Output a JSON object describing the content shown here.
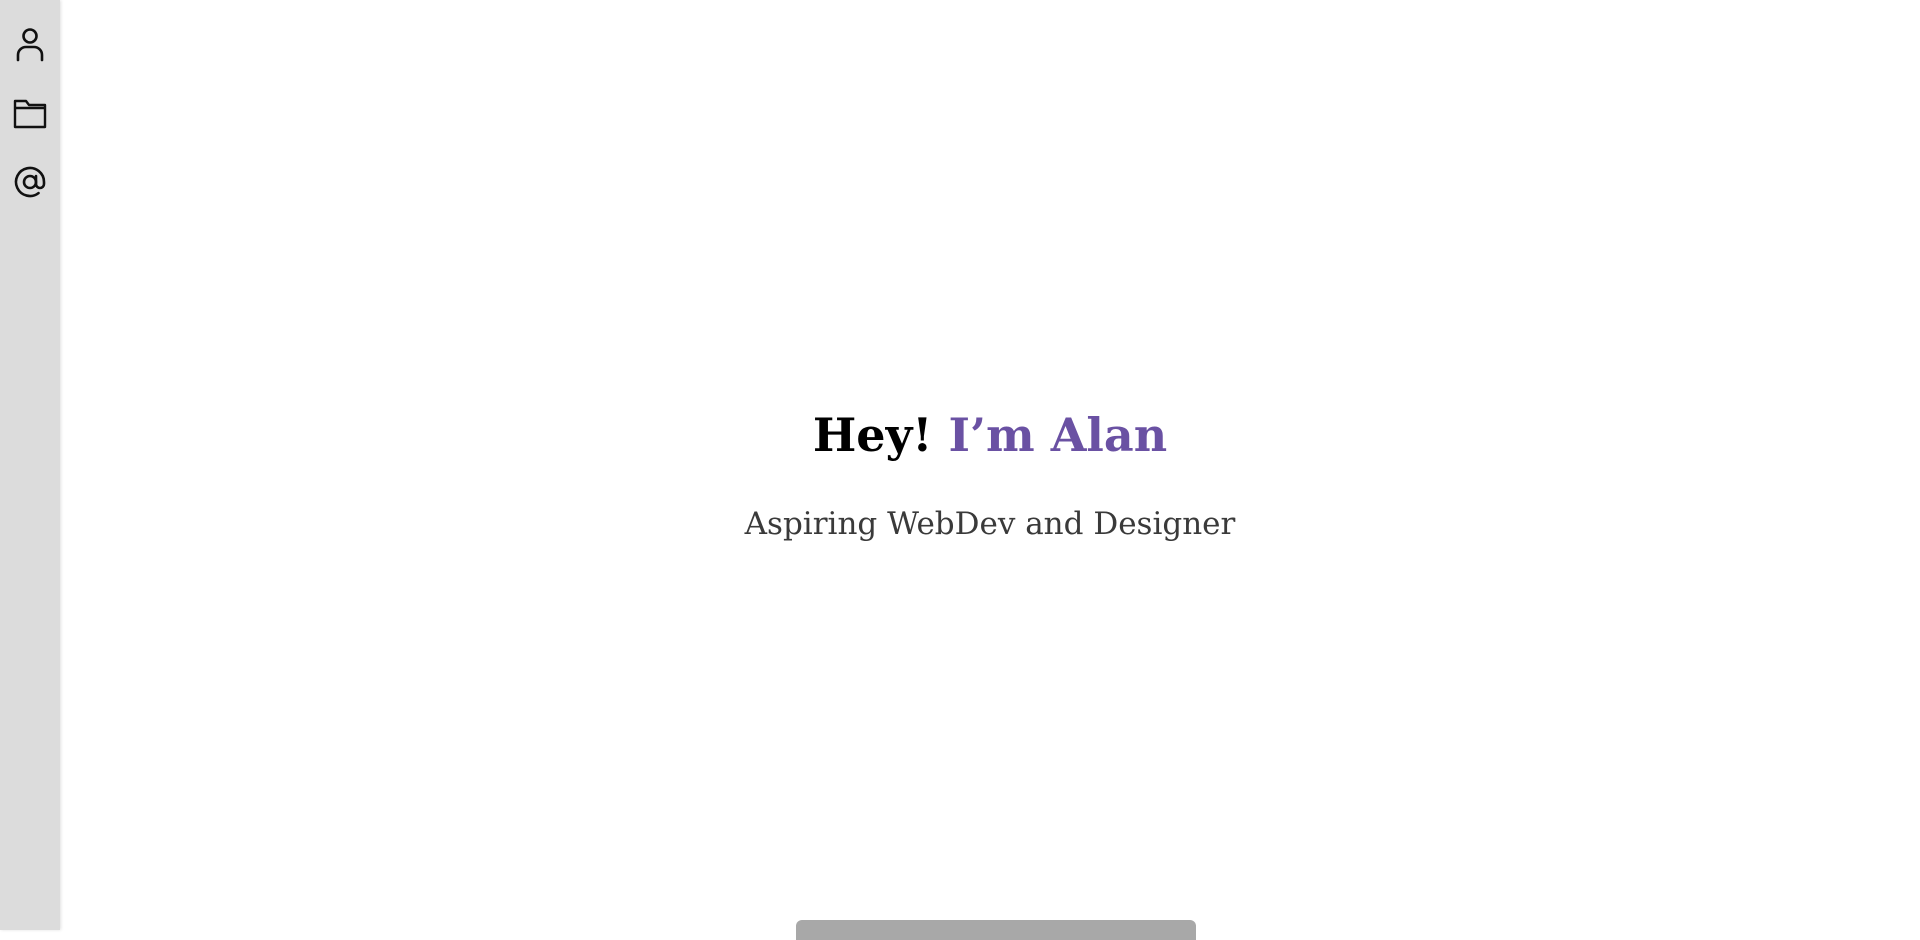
{
  "sidebar": {
    "items": [
      {
        "icon": "person-icon"
      },
      {
        "icon": "folder-icon"
      },
      {
        "icon": "at-sign-icon"
      }
    ]
  },
  "hero": {
    "greeting": "Hey! ",
    "name": "I’m Alan",
    "subtitle": "Aspiring WebDev and Designer"
  },
  "colors": {
    "accent": "#6a51a3",
    "sidebar_bg": "#dcdcdc",
    "bottom_tab": "#a8a8a8"
  }
}
